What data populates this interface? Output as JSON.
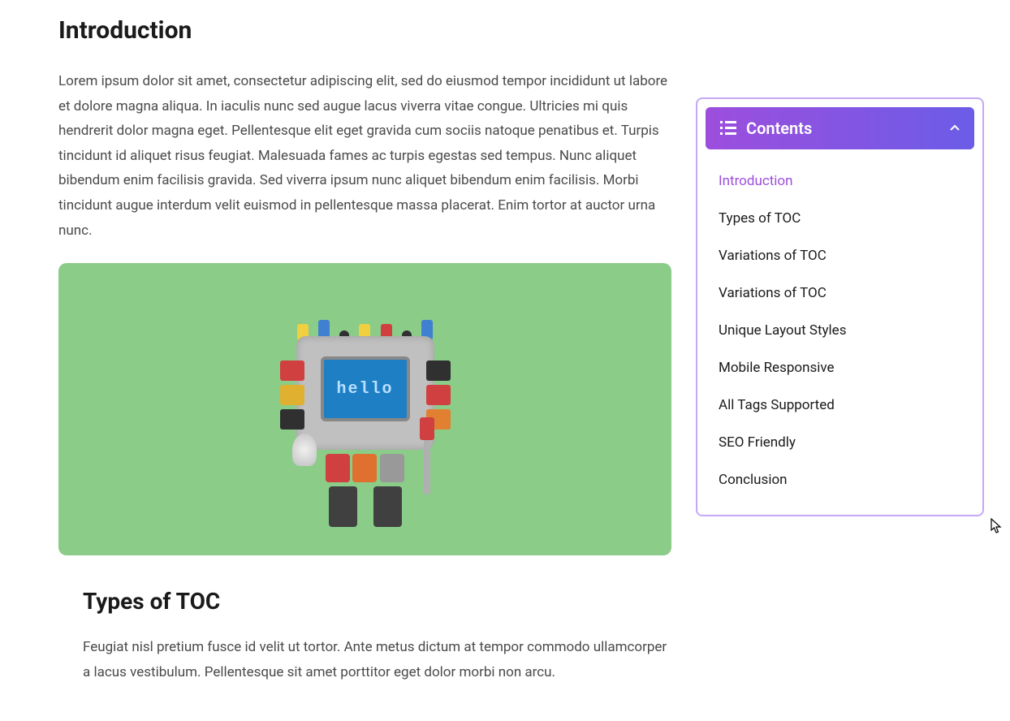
{
  "sections": {
    "intro": {
      "heading": "Introduction",
      "text": "Lorem ipsum dolor sit amet, consectetur adipiscing elit, sed do eiusmod tempor incididunt ut labore et dolore magna aliqua. In iaculis nunc sed augue lacus viverra vitae congue. Ultricies mi quis hendrerit dolor magna eget. Pellentesque elit eget gravida cum sociis natoque penatibus et. Turpis tincidunt id aliquet risus feugiat. Malesuada fames ac turpis egestas sed tempus. Nunc aliquet bibendum enim facilisis gravida. Sed viverra ipsum nunc aliquet bibendum enim facilisis. Morbi tincidunt augue interdum velit euismod in pellentesque massa placerat. Enim tortor at auctor urna nunc."
    },
    "types": {
      "heading": "Types of TOC",
      "text": "Feugiat nisl pretium fusce id velit ut tortor. Ante metus dictum at tempor commodo ullamcorper a lacus vestibulum. Pellentesque sit amet porttitor eget dolor morbi non arcu."
    }
  },
  "image": {
    "screen_text": "hello"
  },
  "toc": {
    "title": "Contents",
    "items": [
      {
        "label": "Introduction",
        "active": true
      },
      {
        "label": "Types of TOC",
        "active": false
      },
      {
        "label": "Variations of TOC",
        "active": false
      },
      {
        "label": "Variations of TOC",
        "active": false
      },
      {
        "label": "Unique Layout Styles",
        "active": false
      },
      {
        "label": "Mobile Responsive",
        "active": false
      },
      {
        "label": "All Tags Supported",
        "active": false
      },
      {
        "label": "SEO Friendly",
        "active": false
      },
      {
        "label": "Conclusion",
        "active": false
      }
    ]
  }
}
